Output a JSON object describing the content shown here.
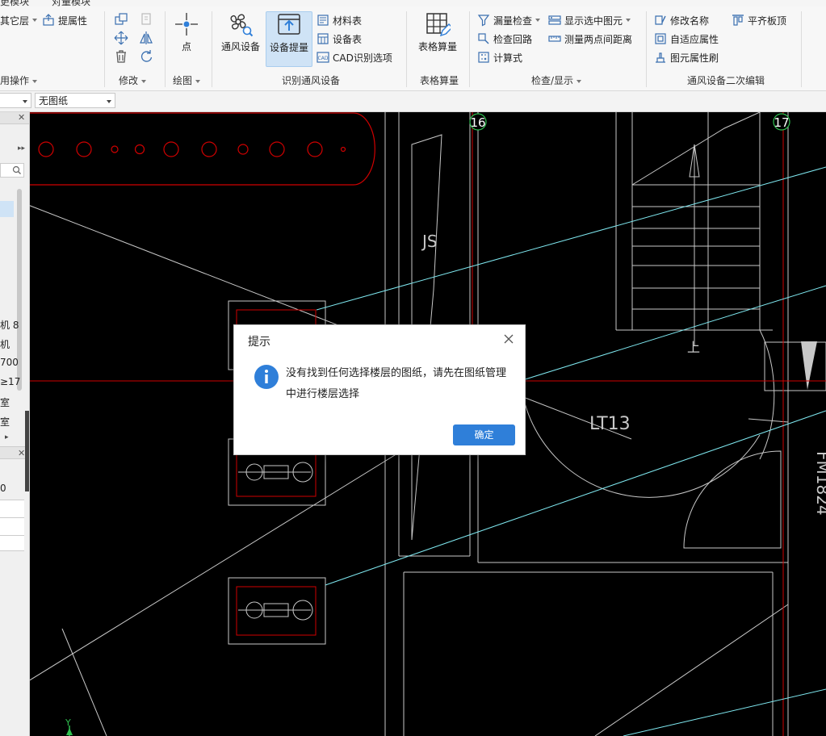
{
  "top_tabs": [
    "更模块",
    "对量模块"
  ],
  "ribbon": {
    "groups": {
      "common": {
        "label": "用操作",
        "other_layer": "其它层",
        "extract_props": "提属性"
      },
      "modify": {
        "label": "修改"
      },
      "draw": {
        "label": "绘图",
        "point": "点"
      },
      "identify": {
        "label": "识别通风设备",
        "ventilation": "通风设备",
        "equipment_extract": "设备提量",
        "material_table": "材料表",
        "equipment_table": "设备表",
        "cad_options": "CAD识别选项"
      },
      "table": {
        "label": "表格算量",
        "table_calc": "表格算量"
      },
      "check": {
        "label": "检查/显示",
        "missing_check": "漏量检查",
        "show_selected": "显示选中图元",
        "check_loop": "检查回路",
        "measure_distance": "测量两点间距离",
        "formula": "计算式"
      },
      "secondary": {
        "label": "通风设备二次编辑",
        "rename": "修改名称",
        "align_top": "平齐板顶",
        "adaptive_props": "自适应属性",
        "prop_brush": "图元属性刷"
      }
    }
  },
  "toolbar": {
    "drawing_select": "无图纸"
  },
  "left_panel": {
    "items": [
      "机 8",
      "机",
      "700",
      "≥17",
      "室",
      "室"
    ],
    "row_value": "0"
  },
  "canvas": {
    "axis_labels": [
      "16",
      "17"
    ],
    "text_labels": [
      "JS",
      "LT13",
      "FM1824",
      "上",
      "Y"
    ]
  },
  "dialog": {
    "title": "提示",
    "message": "没有找到任何选择楼层的图纸，请先在图纸管理中进行楼层选择",
    "ok_label": "确定"
  },
  "colors": {
    "accent": "#2f7fd9",
    "cad_background": "#000000",
    "cad_red": "#d00000",
    "cad_cyan": "#7fe8f0",
    "cad_white": "#c8c8c8",
    "axis_green": "#2fbf4f"
  }
}
